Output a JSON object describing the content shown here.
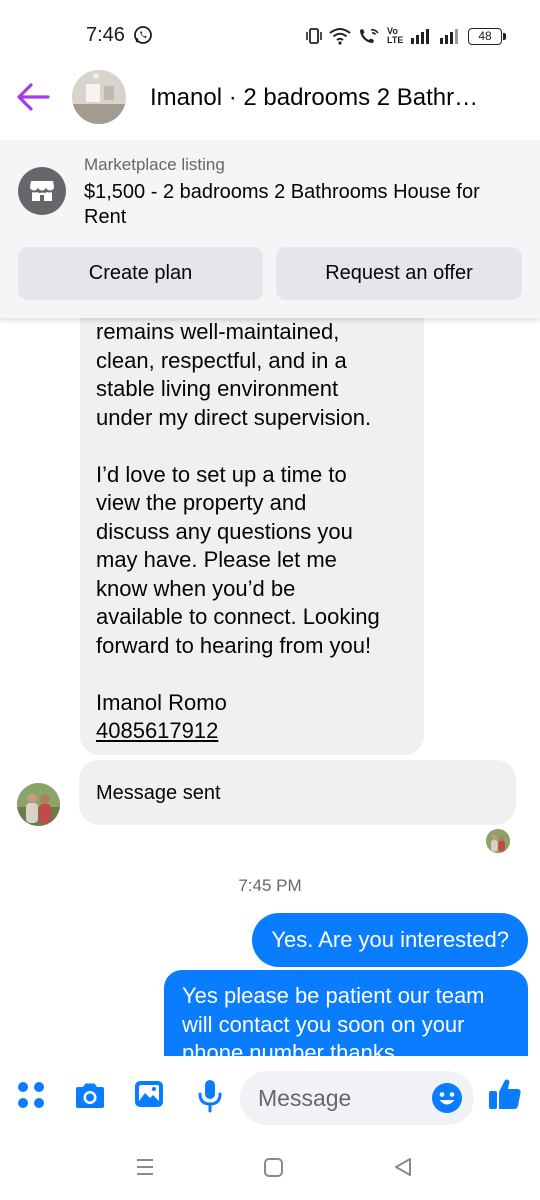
{
  "status_bar": {
    "time": "7:46",
    "lte_label": "Vo LTE",
    "battery": "48"
  },
  "header": {
    "title": "Imanol · 2 badrooms 2 Bathr…"
  },
  "listing": {
    "kicker": "Marketplace listing",
    "title": "$1,500 - 2 badrooms 2 Bathrooms House for Rent",
    "create_plan_label": "Create plan",
    "request_offer_label": "Request an offer"
  },
  "incoming_message": {
    "lines": [
      "remains well-maintained,",
      "clean, respectful, and in a",
      "stable living environment",
      "under my direct supervision.",
      "",
      "I’d love to set up a time to",
      "view the property and",
      "discuss any questions you",
      "may have. Please let me",
      "know when you’d be",
      "available to connect. Looking",
      "forward to hearing from you!",
      "",
      "Imanol Romo"
    ],
    "phone": "4085617912"
  },
  "system_message": "Message sent",
  "timestamp": "7:45 PM",
  "outgoing_messages": [
    "Yes. Are you interested?",
    "Yes please be patient our team will contact you soon on your phone number thanks"
  ],
  "composer": {
    "placeholder": "Message"
  },
  "icons": {
    "back": "back-arrow-icon",
    "store": "marketplace-store-icon",
    "menu": "four-dots-menu-icon",
    "camera": "camera-icon",
    "gallery": "gallery-icon",
    "mic": "microphone-icon",
    "emoji": "emoji-icon",
    "like": "thumbs-up-icon"
  },
  "colors": {
    "accent": "#0a7cff",
    "back_arrow": "#a33ef0",
    "panel_bg": "#f4f5f6",
    "button_bg": "#e4e6eb",
    "incoming_bubble": "#f0f0f0"
  }
}
